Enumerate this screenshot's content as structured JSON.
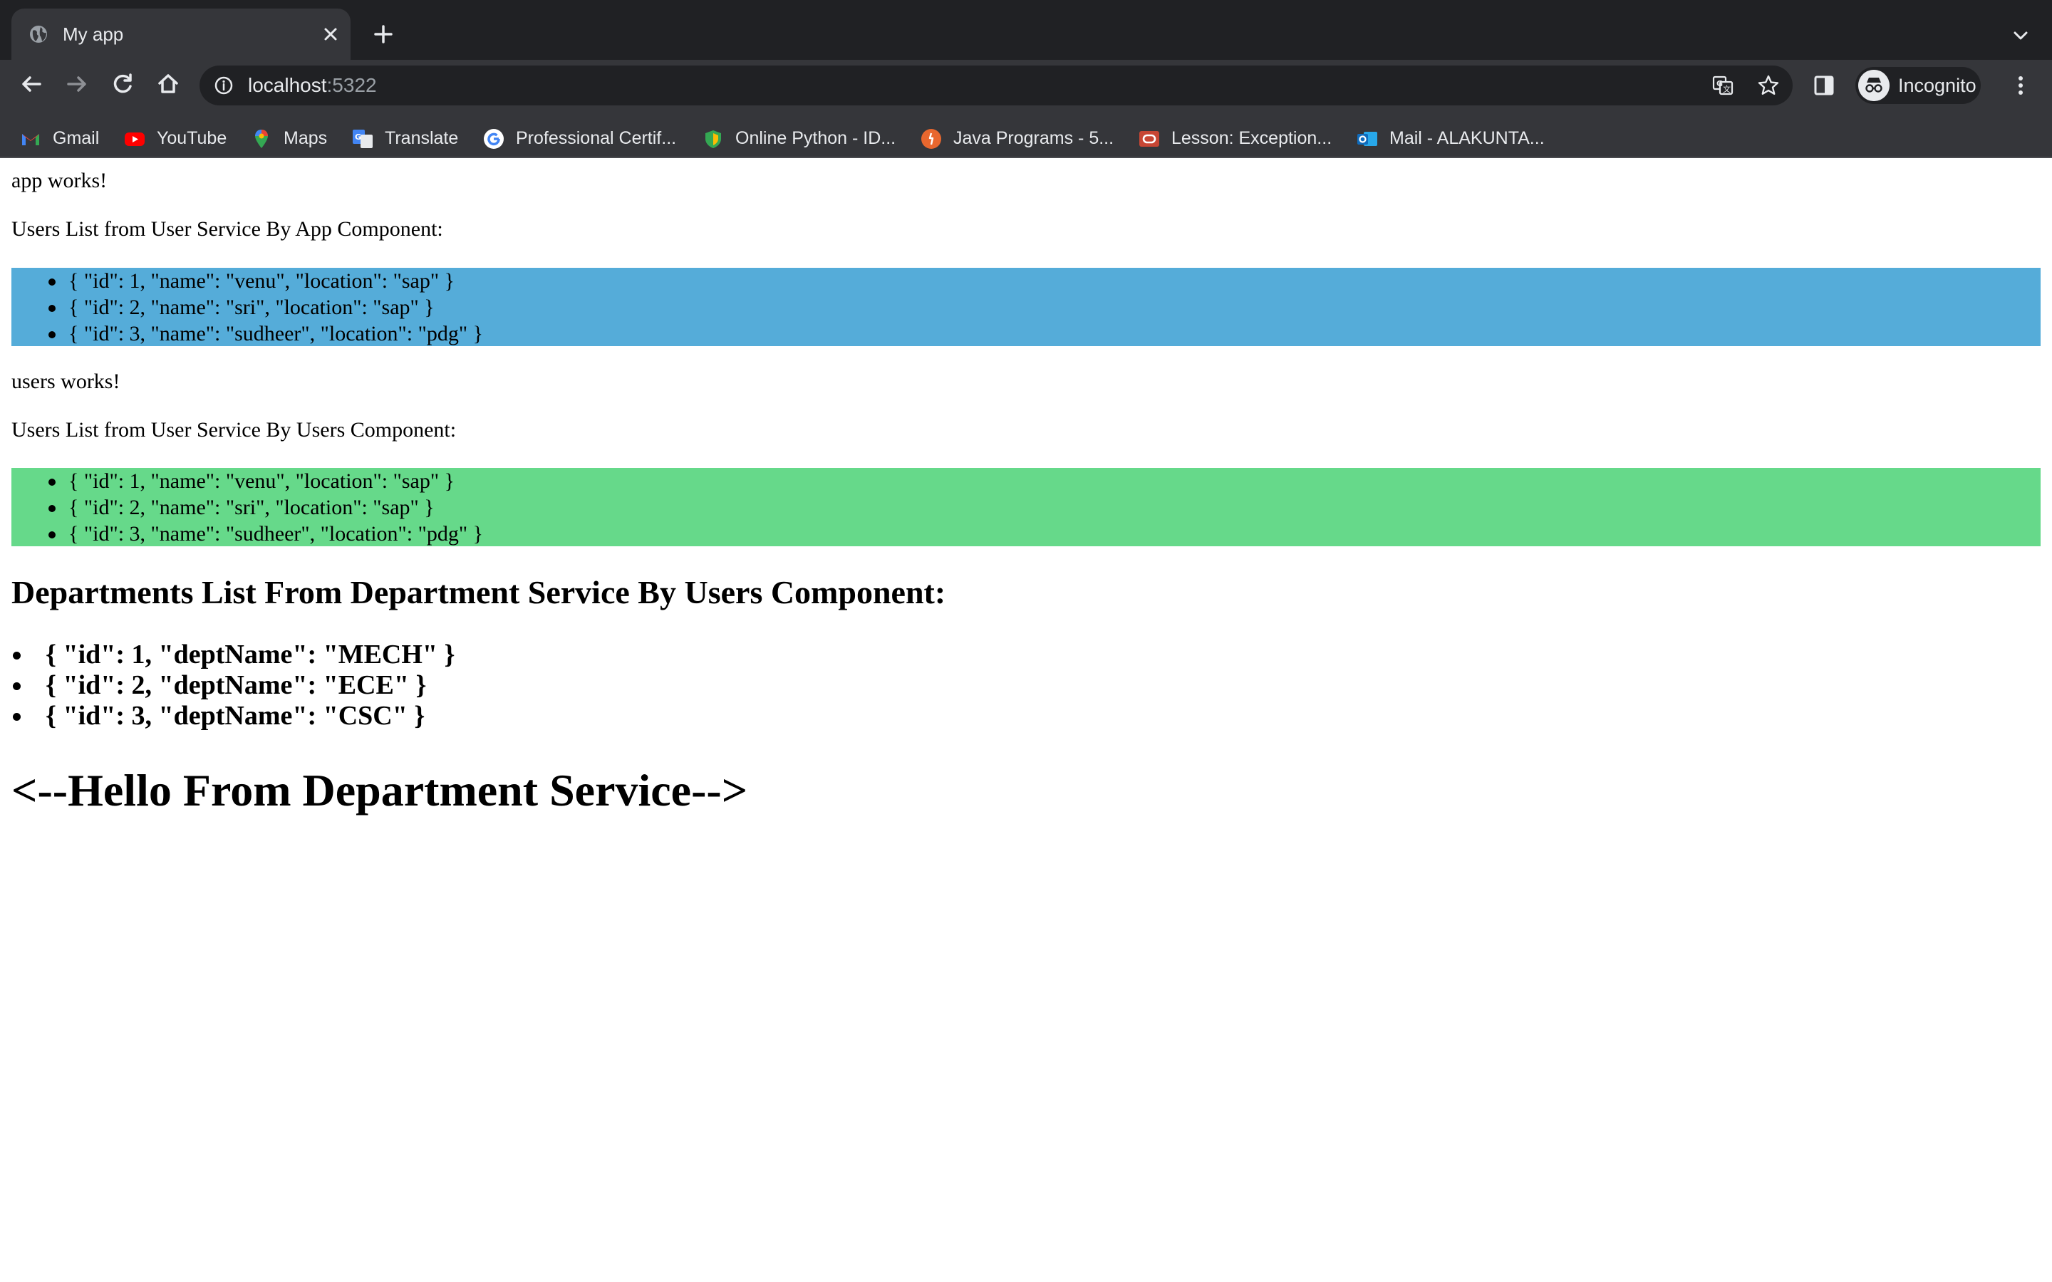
{
  "browser": {
    "tab": {
      "title": "My app"
    },
    "address": {
      "host": "localhost",
      "port": ":5322"
    },
    "profile": {
      "label": "Incognito"
    },
    "bookmarks": [
      {
        "label": "Gmail",
        "icon": "gmail-icon",
        "color": "#ea4335"
      },
      {
        "label": "YouTube",
        "icon": "youtube-icon",
        "color": "#ff0000"
      },
      {
        "label": "Maps",
        "icon": "maps-icon",
        "color": "#34a853"
      },
      {
        "label": "Translate",
        "icon": "translate-icon",
        "color": "#4285f4"
      },
      {
        "label": "Professional Certif...",
        "icon": "google-icon",
        "color": "#4285f4"
      },
      {
        "label": "Online Python - ID...",
        "icon": "python-shield-icon",
        "color": "#fbbc05"
      },
      {
        "label": "Java Programs - 5...",
        "icon": "java-icon",
        "color": "#e8672e"
      },
      {
        "label": "Lesson: Exception...",
        "icon": "oracle-icon",
        "color": "#c74634"
      },
      {
        "label": "Mail - ALAKUNTA...",
        "icon": "outlook-icon",
        "color": "#0f6cbd"
      }
    ]
  },
  "page": {
    "app_works": "app works!",
    "app_users_heading": "Users List from User Service By App Component:",
    "app_users": [
      "{ \"id\": 1, \"name\": \"venu\", \"location\": \"sap\" }",
      "{ \"id\": 2, \"name\": \"sri\", \"location\": \"sap\" }",
      "{ \"id\": 3, \"name\": \"sudheer\", \"location\": \"pdg\" }"
    ],
    "users_works": "users works!",
    "users_users_heading": "Users List from User Service By Users Component:",
    "users_users": [
      "{ \"id\": 1, \"name\": \"venu\", \"location\": \"sap\" }",
      "{ \"id\": 2, \"name\": \"sri\", \"location\": \"sap\" }",
      "{ \"id\": 3, \"name\": \"sudheer\", \"location\": \"pdg\" }"
    ],
    "departments_heading": "Departments List From Department Service By Users Component:",
    "departments": [
      "{ \"id\": 1, \"deptName\": \"MECH\" }",
      "{ \"id\": 2, \"deptName\": \"ECE\" }",
      "{ \"id\": 3, \"deptName\": \"CSC\" }"
    ],
    "hello": "<--Hello From Department Service-->"
  },
  "colors": {
    "app_users_bg": "#55acd9",
    "users_users_bg": "#66d98a",
    "chrome_dark": "#202124",
    "chrome_toolbar": "#35363a"
  }
}
